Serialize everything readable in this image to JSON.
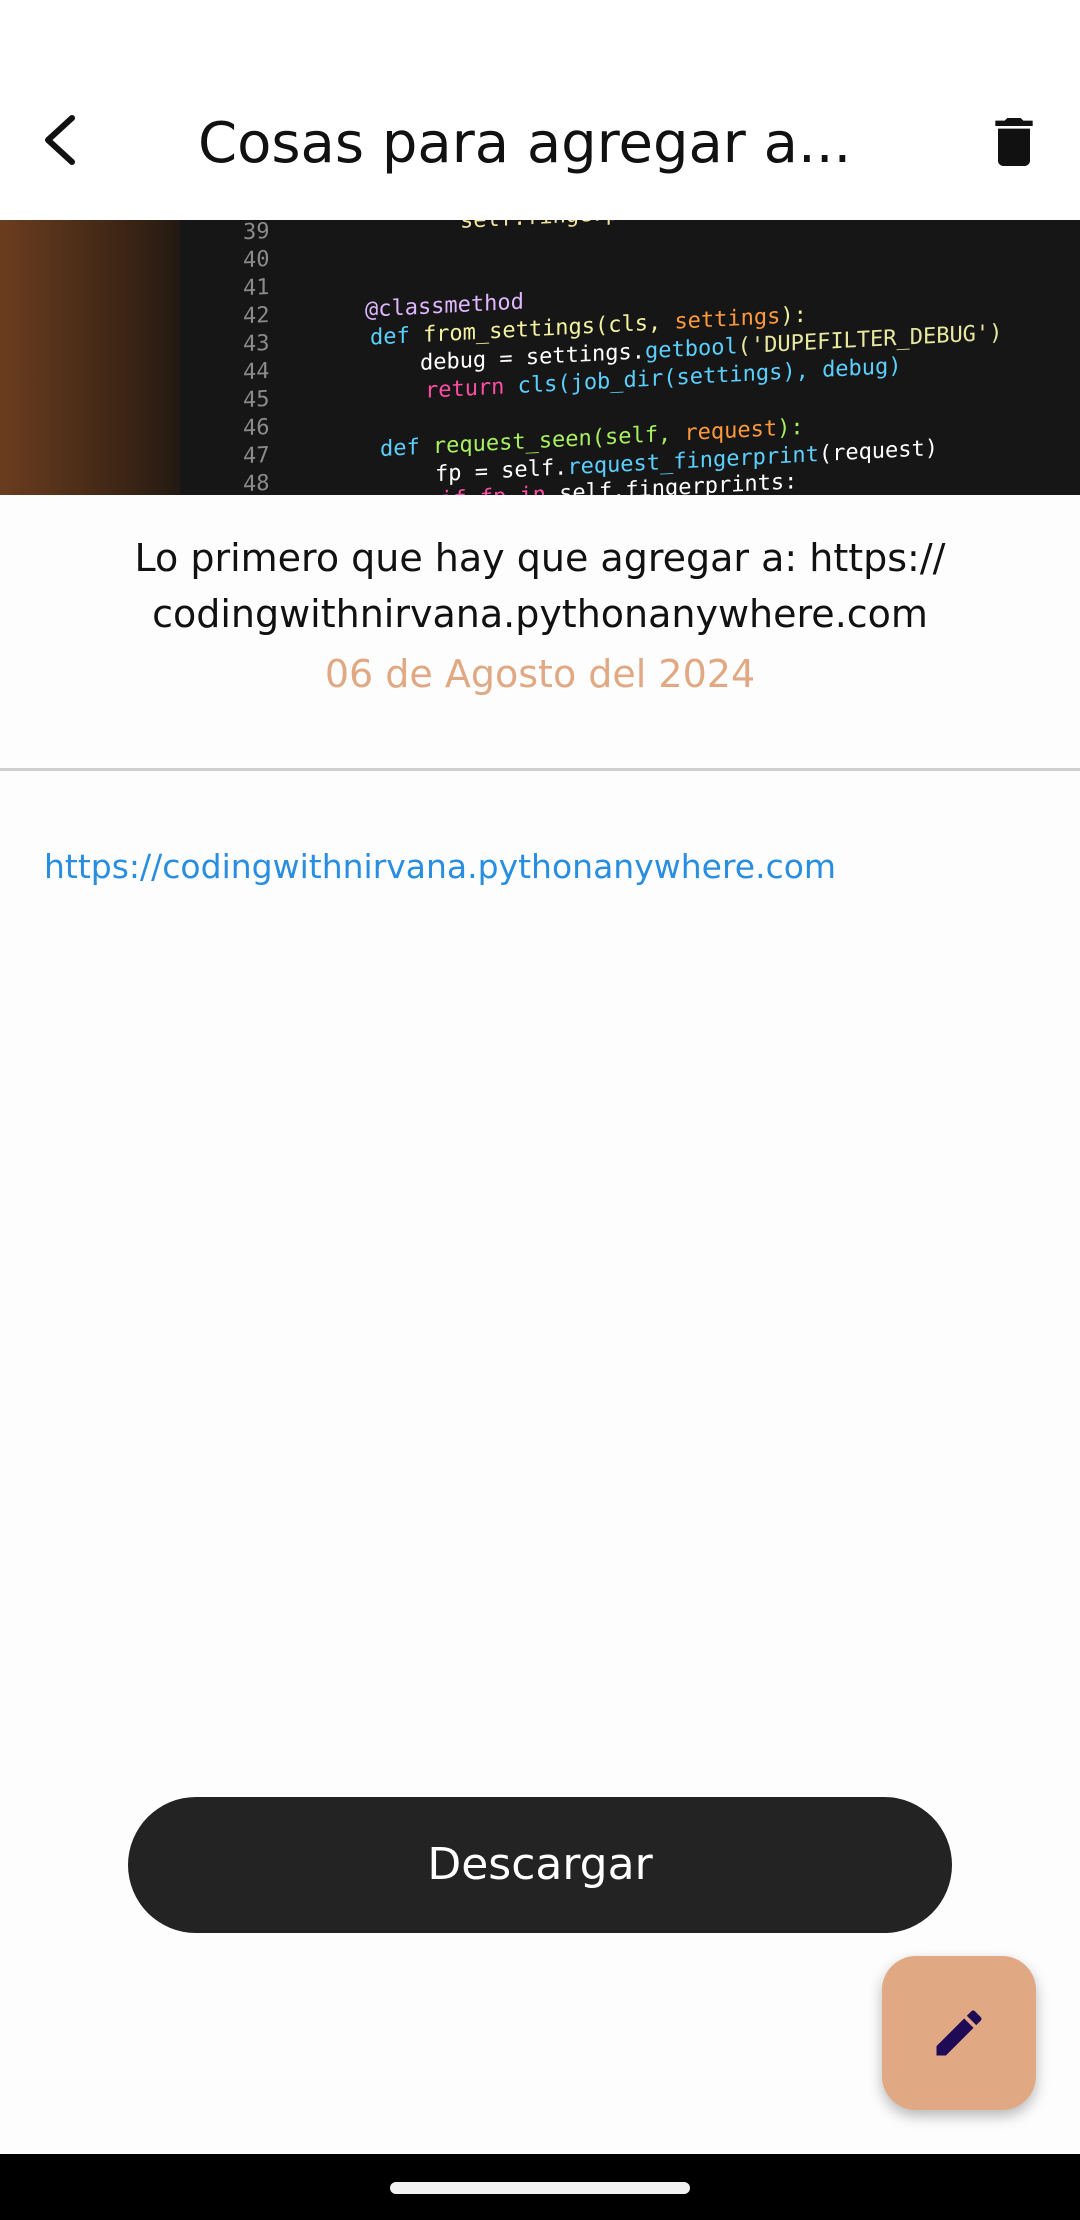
{
  "app_bar": {
    "title": "Cosas para agregar a...",
    "back_icon": "arrow-back-icon",
    "delete_icon": "trash-icon"
  },
  "note": {
    "description": "Lo primero que hay que agregar a: https:// codingwithnirvana.pythonanywhere.com",
    "date": "06 de Agosto del 2024",
    "link": "https://codingwithnirvana.pythonanywhere.com"
  },
  "hero_image": {
    "code_lines": [
      {
        "num": "39",
        "code": "self.fingerprints."
      },
      {
        "num": "40",
        "code": ""
      },
      {
        "num": "41",
        "code": ""
      },
      {
        "num": "42",
        "code": "@classmethod"
      },
      {
        "num": "43",
        "code": "def from_settings(cls, settings):"
      },
      {
        "num": "44",
        "code": "debug = settings.getbool('DUPEFILTER_DEBUG')"
      },
      {
        "num": "45",
        "code": "return cls(job_dir(settings), debug)"
      },
      {
        "num": "46",
        "code": ""
      },
      {
        "num": "47",
        "code": "def request_seen(self, request):"
      },
      {
        "num": "48",
        "code": "fp = self.request_fingerprint(request)"
      },
      {
        "num": "",
        "code": "if fp in self.fingerprints:"
      }
    ]
  },
  "actions": {
    "download_label": "Descargar",
    "edit_icon": "pencil-icon"
  },
  "colors": {
    "accent": "#e0a984",
    "link": "#2a8ee0",
    "button_dark": "#232323"
  }
}
